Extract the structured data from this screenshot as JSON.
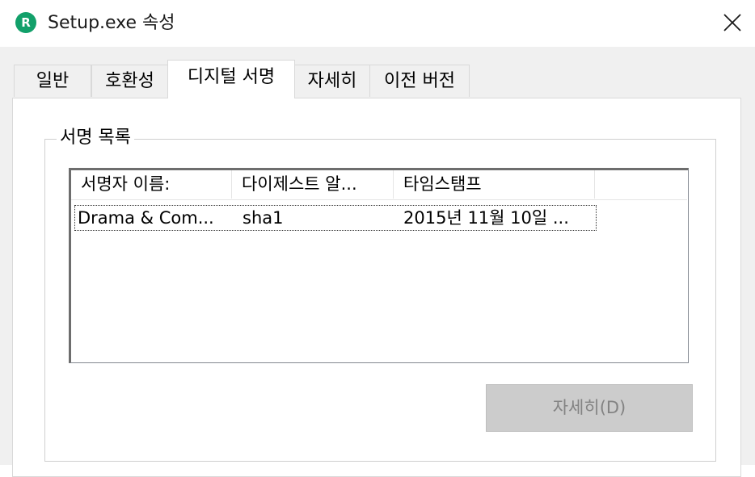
{
  "window": {
    "title": "Setup.exe 속성",
    "icon_letter": "R",
    "icon_color": "#12a06a"
  },
  "tabs": [
    {
      "label": "일반"
    },
    {
      "label": "호환성"
    },
    {
      "label": "디지털 서명",
      "active": true
    },
    {
      "label": "자세히"
    },
    {
      "label": "이전 버전"
    }
  ],
  "signature_group": {
    "label": "서명 목록",
    "columns": [
      "서명자 이름:",
      "다이제스트 알...",
      "타임스탬프"
    ],
    "rows": [
      {
        "signer": "Drama & Com...",
        "digest": "sha1",
        "timestamp": "2015년 11월 10일 ..."
      }
    ]
  },
  "details_button": {
    "label": "자세히(D)",
    "enabled": false
  }
}
